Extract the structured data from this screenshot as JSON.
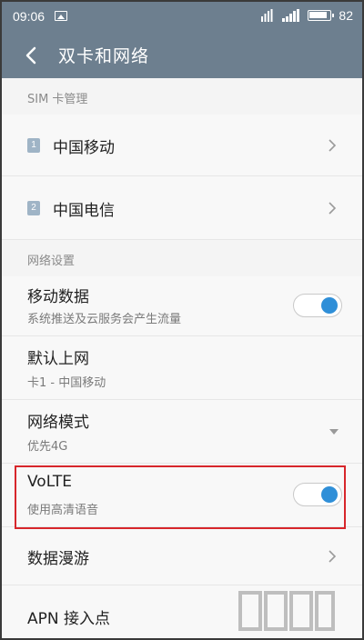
{
  "status_bar": {
    "time": "09:06",
    "battery_level": "82",
    "icons": [
      "image-icon",
      "wifi-icon",
      "signal-icon",
      "battery-icon"
    ]
  },
  "header": {
    "title": "双卡和网络",
    "back_icon": "chevron-left-icon",
    "background_color": "#6d7f8f"
  },
  "sim_section": {
    "header": "SIM 卡管理",
    "items": [
      {
        "badge": "1",
        "label": "中国移动"
      },
      {
        "badge": "2",
        "label": "中国电信"
      }
    ]
  },
  "network_section": {
    "header": "网络设置",
    "mobile_data": {
      "title": "移动数据",
      "subtitle": "系统推送及云服务会产生流量",
      "enabled": true
    },
    "default_internet": {
      "title": "默认上网",
      "subtitle": "卡1 - 中国移动"
    },
    "network_mode": {
      "title": "网络模式",
      "subtitle": "优先4G"
    },
    "volte": {
      "title": "VoLTE",
      "subtitle": "使用高清语音",
      "enabled": true
    },
    "data_roaming": {
      "title": "数据漫游"
    },
    "apn": {
      "title": "APN 接入点"
    }
  },
  "colors": {
    "toggle_on": "#2f8fd8",
    "highlight": "#d7262b"
  }
}
